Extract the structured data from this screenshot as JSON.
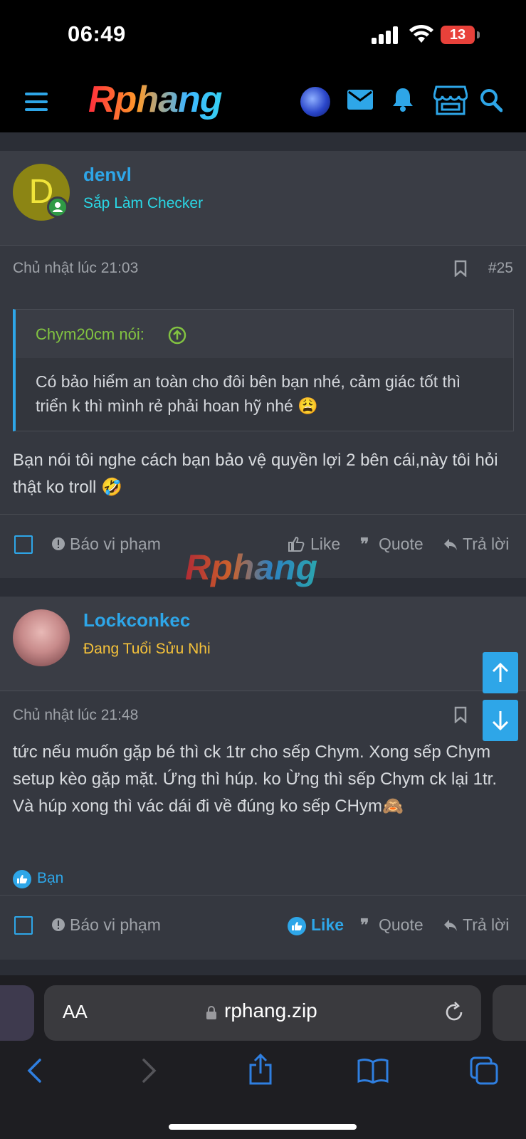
{
  "status_bar": {
    "time": "06:49",
    "battery": "13"
  },
  "navbar": {
    "logo": "Rphang"
  },
  "posts": [
    {
      "avatar_letter": "D",
      "username": "denvl",
      "user_title": "Sắp Làm Checker",
      "user_title_color": "#2ad8e6",
      "timestamp": "Chủ nhật lúc 21:03",
      "post_number": "#25",
      "quote": {
        "author": "Chym20cm nói:",
        "text": "Có bảo hiểm an toàn cho đôi bên bạn nhé, cảm giác tốt thì triển k thì mình rẻ phải hoan hỹ nhé 😩"
      },
      "body": "Bạn nói tôi nghe cách bạn bảo vệ quyền lợi 2 bên cái,này tôi hỏi thật ko troll 🤣",
      "actions": {
        "report": "Báo vi phạm",
        "like": "Like",
        "quote": "Quote",
        "reply": "Trả lời"
      }
    },
    {
      "username": "Lockconkec",
      "user_title": "Đang Tuổi Sửu Nhi",
      "user_title_color": "#f5c23a",
      "timestamp": "Chủ nhật lúc 21:48",
      "body": "tức nếu muốn gặp bé thì ck 1tr cho sếp Chym. Xong sếp Chym setup kèo gặp mặt. Ứng thì húp. ko Ừng thì sếp Chym ck lại 1tr. Và húp xong thì vác dái đi về đúng ko sếp CHym🙈",
      "reaction": "Bạn",
      "actions": {
        "report": "Báo vi phạm",
        "like": "Like",
        "quote": "Quote",
        "reply": "Trả lời"
      }
    }
  ],
  "watermark": "Rphang",
  "browser": {
    "text_size": "AA",
    "url": "rphang.zip"
  }
}
